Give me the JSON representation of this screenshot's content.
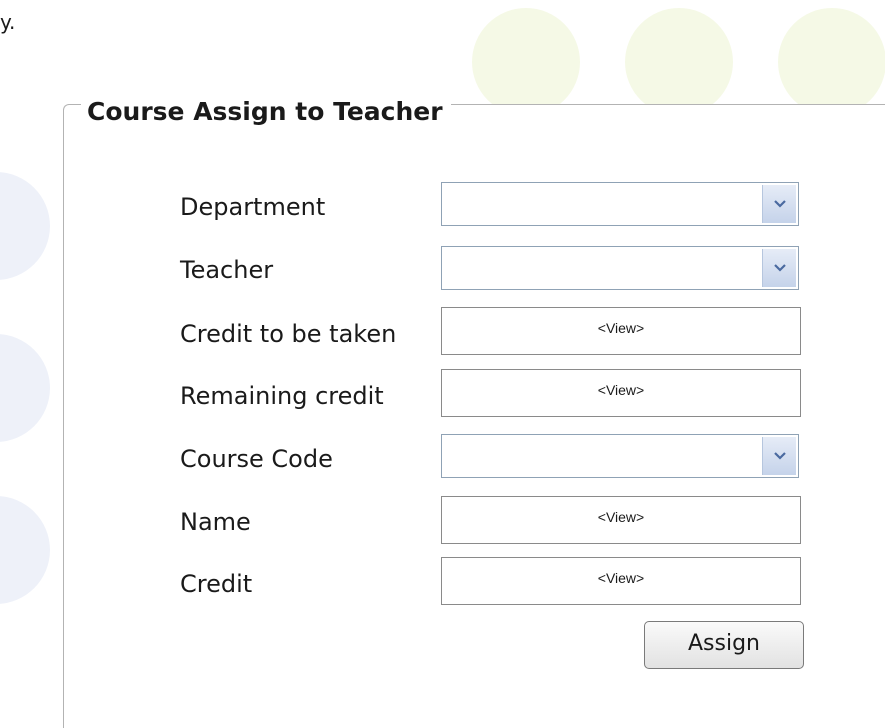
{
  "page": {
    "top_fragment": "y."
  },
  "form": {
    "title": "Course Assign to Teacher",
    "rows": [
      {
        "label": "Department",
        "type": "select",
        "value": ""
      },
      {
        "label": "Teacher",
        "type": "select",
        "value": ""
      },
      {
        "label": "Credit to be taken",
        "type": "view",
        "value": "<View>"
      },
      {
        "label": "Remaining credit",
        "type": "view",
        "value": "<View>"
      },
      {
        "label": "Course Code",
        "type": "select",
        "value": ""
      },
      {
        "label": "Name",
        "type": "view",
        "value": "<View>"
      },
      {
        "label": "Credit",
        "type": "view",
        "value": "<View>"
      }
    ],
    "assign_label": "Assign"
  },
  "colors": {
    "top_blob": "#f5f9e6",
    "left_blob": "#eef1f9",
    "select_border": "#8fa2b5",
    "arrow_fill": "#4a6aa0"
  },
  "icons": {
    "dropdown": "chevron-down-icon"
  }
}
